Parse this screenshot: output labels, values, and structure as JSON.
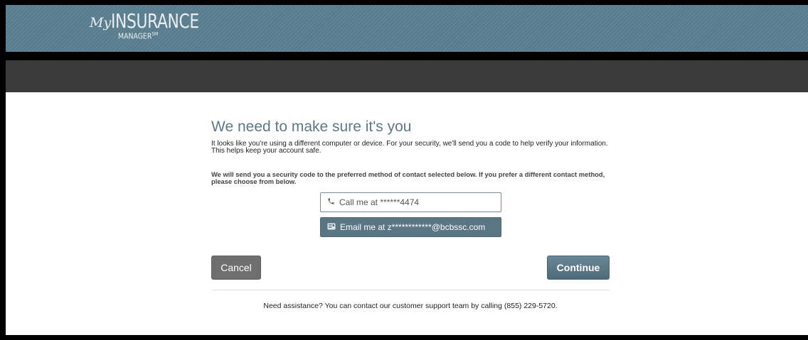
{
  "app": {
    "logo_my": "My",
    "logo_main": "INSURANCE",
    "logo_sub": "MANAGER",
    "logo_mark": "SM"
  },
  "verify": {
    "title": "We need to make sure it's you",
    "intro": "It looks like you're using a different computer or device. For your security, we'll send you a code to help verify your information. This helps keep your account safe.",
    "method_note": "We will send you a security code to the preferred method of contact selected below. If you prefer a different contact method, please choose from below.",
    "options": [
      {
        "icon": "phone-icon",
        "label": "Call me at ******4474",
        "selected": false
      },
      {
        "icon": "email-icon",
        "label": "Email me at z************@bcbssc.com",
        "selected": true
      }
    ],
    "cancel_label": "Cancel",
    "continue_label": "Continue",
    "support_text": "Need assistance? You can contact our customer support team by calling (855) 229-5720."
  },
  "colors": {
    "header": "#5b7f91",
    "navbar": "#3b3b3b",
    "title": "#5d7886",
    "primary_button": "#5a7584",
    "cancel_button": "#6f6f6f"
  }
}
